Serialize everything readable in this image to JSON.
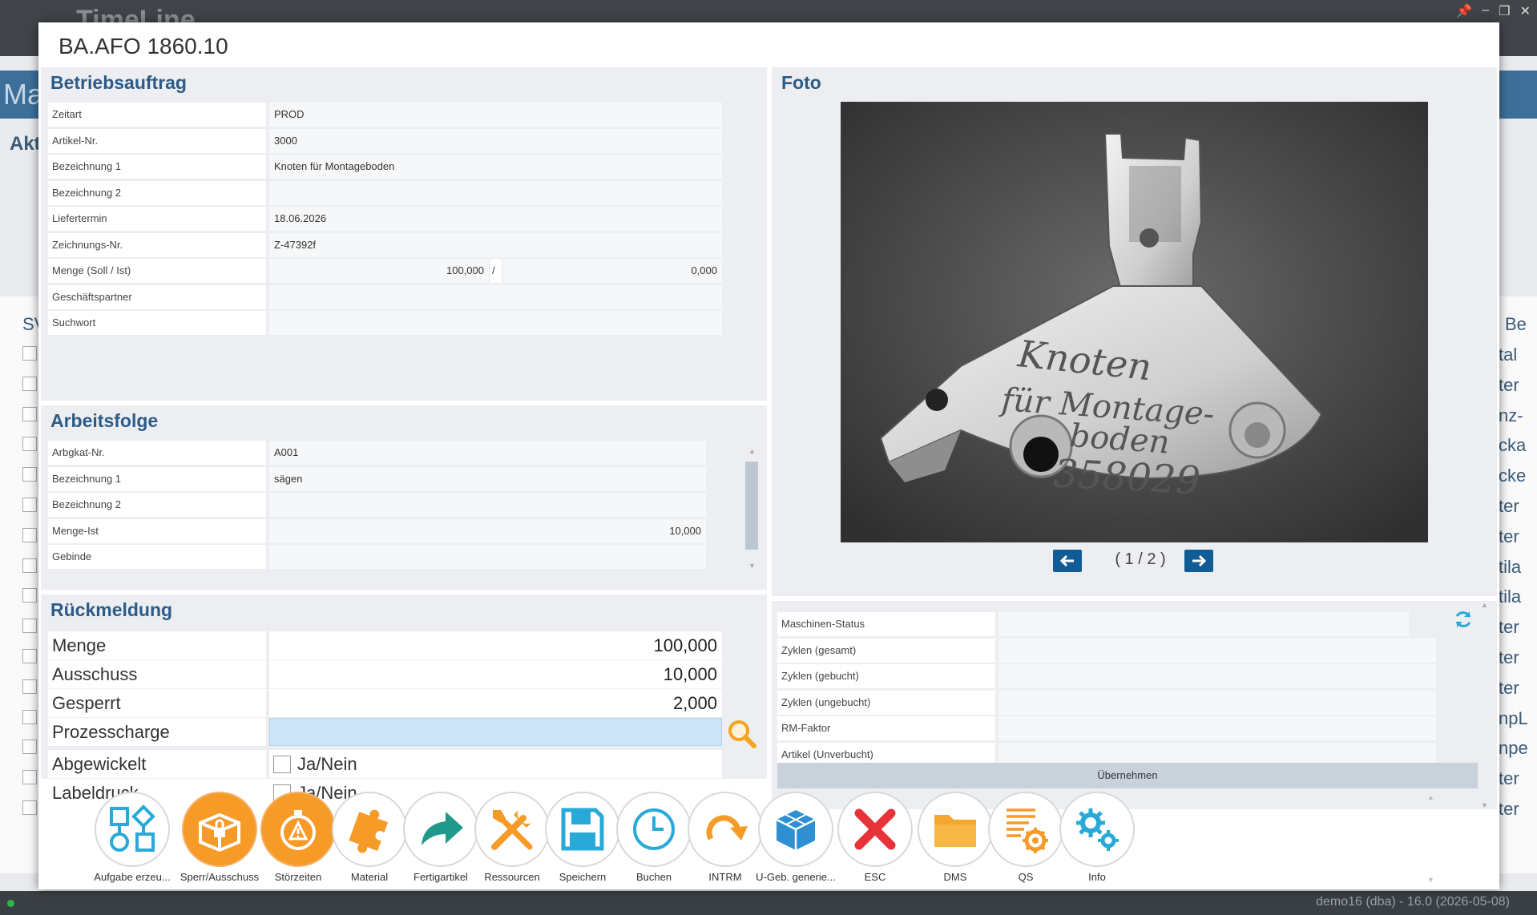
{
  "app": {
    "title": "TimeLine",
    "bar_text": "Ma",
    "akt_label": "Akt",
    "column_left": "SV",
    "column_right": "Be",
    "right_items": [
      "tal",
      "ter",
      "nz-",
      "cka",
      "cke",
      "ter",
      "ter",
      "tila",
      "tila",
      "ter",
      "ter",
      "ter",
      "npL",
      "npe",
      "ter",
      "ter"
    ],
    "status_text": "demo16 (dba) - 16.0 (2026-05-08)"
  },
  "dialog": {
    "title": "BA.AFO 1860.10"
  },
  "betriebsauftrag": {
    "title": "Betriebsauftrag",
    "rows": [
      {
        "label": "Zeitart",
        "value": "PROD"
      },
      {
        "label": "Artikel-Nr.",
        "value": "3000"
      },
      {
        "label": "Bezeichnung 1",
        "value": "Knoten für Montageboden"
      },
      {
        "label": "Bezeichnung 2",
        "value": ""
      },
      {
        "label": "Liefertermin",
        "value": "18.06.2026"
      },
      {
        "label": "Zeichnungs-Nr.",
        "value": "Z-47392f"
      }
    ],
    "menge_label": "Menge (Soll / Ist)",
    "menge_soll": "100,000",
    "menge_sep": "/",
    "menge_ist": "0,000",
    "rows2": [
      {
        "label": "Geschäftspartner",
        "value": ""
      },
      {
        "label": "Suchwort",
        "value": ""
      }
    ]
  },
  "foto": {
    "title": "Foto",
    "caption": "( 1 / 2 )",
    "handwriting": [
      "Knoten",
      "für Montage-",
      "boden",
      "358029"
    ]
  },
  "arbeitsfolge": {
    "title": "Arbeitsfolge",
    "rows": [
      {
        "label": "Arbgkat-Nr.",
        "value": "A001",
        "align": "left"
      },
      {
        "label": "Bezeichnung 1",
        "value": "sägen",
        "align": "left"
      },
      {
        "label": "Bezeichnung 2",
        "value": "",
        "align": "left"
      },
      {
        "label": "Menge-Ist",
        "value": "10,000",
        "align": "right"
      },
      {
        "label": "Gebinde",
        "value": "",
        "align": "left"
      }
    ]
  },
  "rueckmeldung": {
    "title": "Rückmeldung",
    "menge_label": "Menge",
    "menge_value": "100,000",
    "ausschuss_label": "Ausschuss",
    "ausschuss_value": "10,000",
    "gesperrt_label": "Gesperrt",
    "gesperrt_value": "2,000",
    "prozesscharge_label": "Prozesscharge",
    "prozesscharge_value": "",
    "abgewickelt_label": "Abgewickelt",
    "abgewickelt_check": "Ja/Nein",
    "labeldruck_label": "Labeldruck",
    "labeldruck_check": "Ja/Nein"
  },
  "maschine": {
    "rows": [
      {
        "label": "Maschinen-Status",
        "value": ""
      },
      {
        "label": "Zyklen (gesamt)",
        "value": ""
      },
      {
        "label": "Zyklen (gebucht)",
        "value": ""
      },
      {
        "label": "Zyklen (ungebucht)",
        "value": ""
      },
      {
        "label": "RM-Faktor",
        "value": ""
      },
      {
        "label": "Artikel (Unverbucht)",
        "value": ""
      }
    ],
    "uebernehmen": "Übernehmen"
  },
  "toolbar": {
    "buttons": [
      {
        "label": "Aufgabe erzeu...",
        "icon": "workflow-icon",
        "active": false
      },
      {
        "label": "Sperr/Ausschuss",
        "icon": "locked-box-icon",
        "active": true
      },
      {
        "label": "Störzeiten",
        "icon": "stopwatch-alert-icon",
        "active": true
      },
      {
        "label": "Material",
        "icon": "puzzle-icon",
        "active": false
      },
      {
        "label": "Fertigartikel",
        "icon": "forward-arrow-icon",
        "active": false
      },
      {
        "label": "Ressourcen",
        "icon": "tools-icon",
        "active": false
      },
      {
        "label": "Speichern",
        "icon": "save-icon",
        "active": false
      },
      {
        "label": "Buchen",
        "icon": "clock-icon",
        "active": false
      },
      {
        "label": "INTRM",
        "icon": "redo-icon",
        "active": false
      },
      {
        "label": "U-Geb. generie...",
        "icon": "cubes-icon",
        "active": false
      },
      {
        "label": "ESC",
        "icon": "close-x-icon",
        "active": false
      },
      {
        "label": "DMS",
        "icon": "folder-icon",
        "active": false
      },
      {
        "label": "QS",
        "icon": "document-gear-icon",
        "active": false
      },
      {
        "label": "Info",
        "icon": "gears-icon",
        "active": false
      }
    ]
  },
  "colors": {
    "accent_blue": "#2c5b87",
    "orange": "#f69a28",
    "teal": "#1f9a8a",
    "cyan": "#29a9d8",
    "red": "#e8323a",
    "nav_button": "#0f5c96"
  }
}
